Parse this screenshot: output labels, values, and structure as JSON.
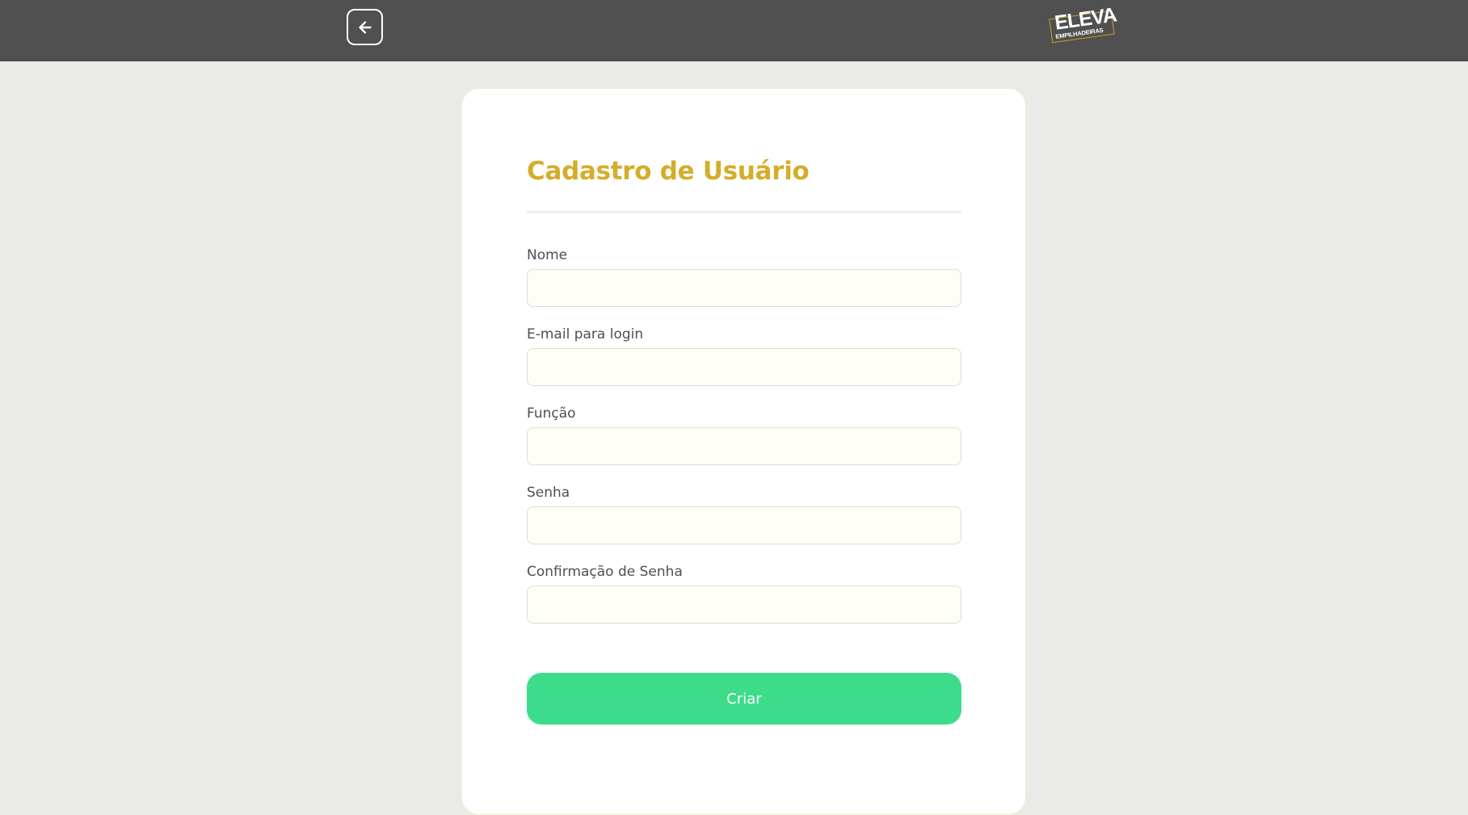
{
  "header": {
    "back_icon": "arrow-left-icon",
    "logo": {
      "main": "ELEVA",
      "sub": "EMPILHADEIRAS"
    }
  },
  "form": {
    "title": "Cadastro de Usuário",
    "fields": [
      {
        "label": "Nome",
        "value": "",
        "placeholder": ""
      },
      {
        "label": "E-mail para login",
        "value": "",
        "placeholder": ""
      },
      {
        "label": "Função",
        "value": "",
        "placeholder": ""
      },
      {
        "label": "Senha",
        "value": "",
        "placeholder": ""
      },
      {
        "label": "Confirmação de Senha",
        "value": "",
        "placeholder": ""
      }
    ],
    "submit_label": "Criar"
  },
  "colors": {
    "header_bg": "#505050",
    "page_bg": "#eaeae8",
    "title": "#d4ad2a",
    "submit_bg": "#3ddc8b",
    "input_bg": "#fefef6",
    "logo_accent": "#c9a227"
  }
}
